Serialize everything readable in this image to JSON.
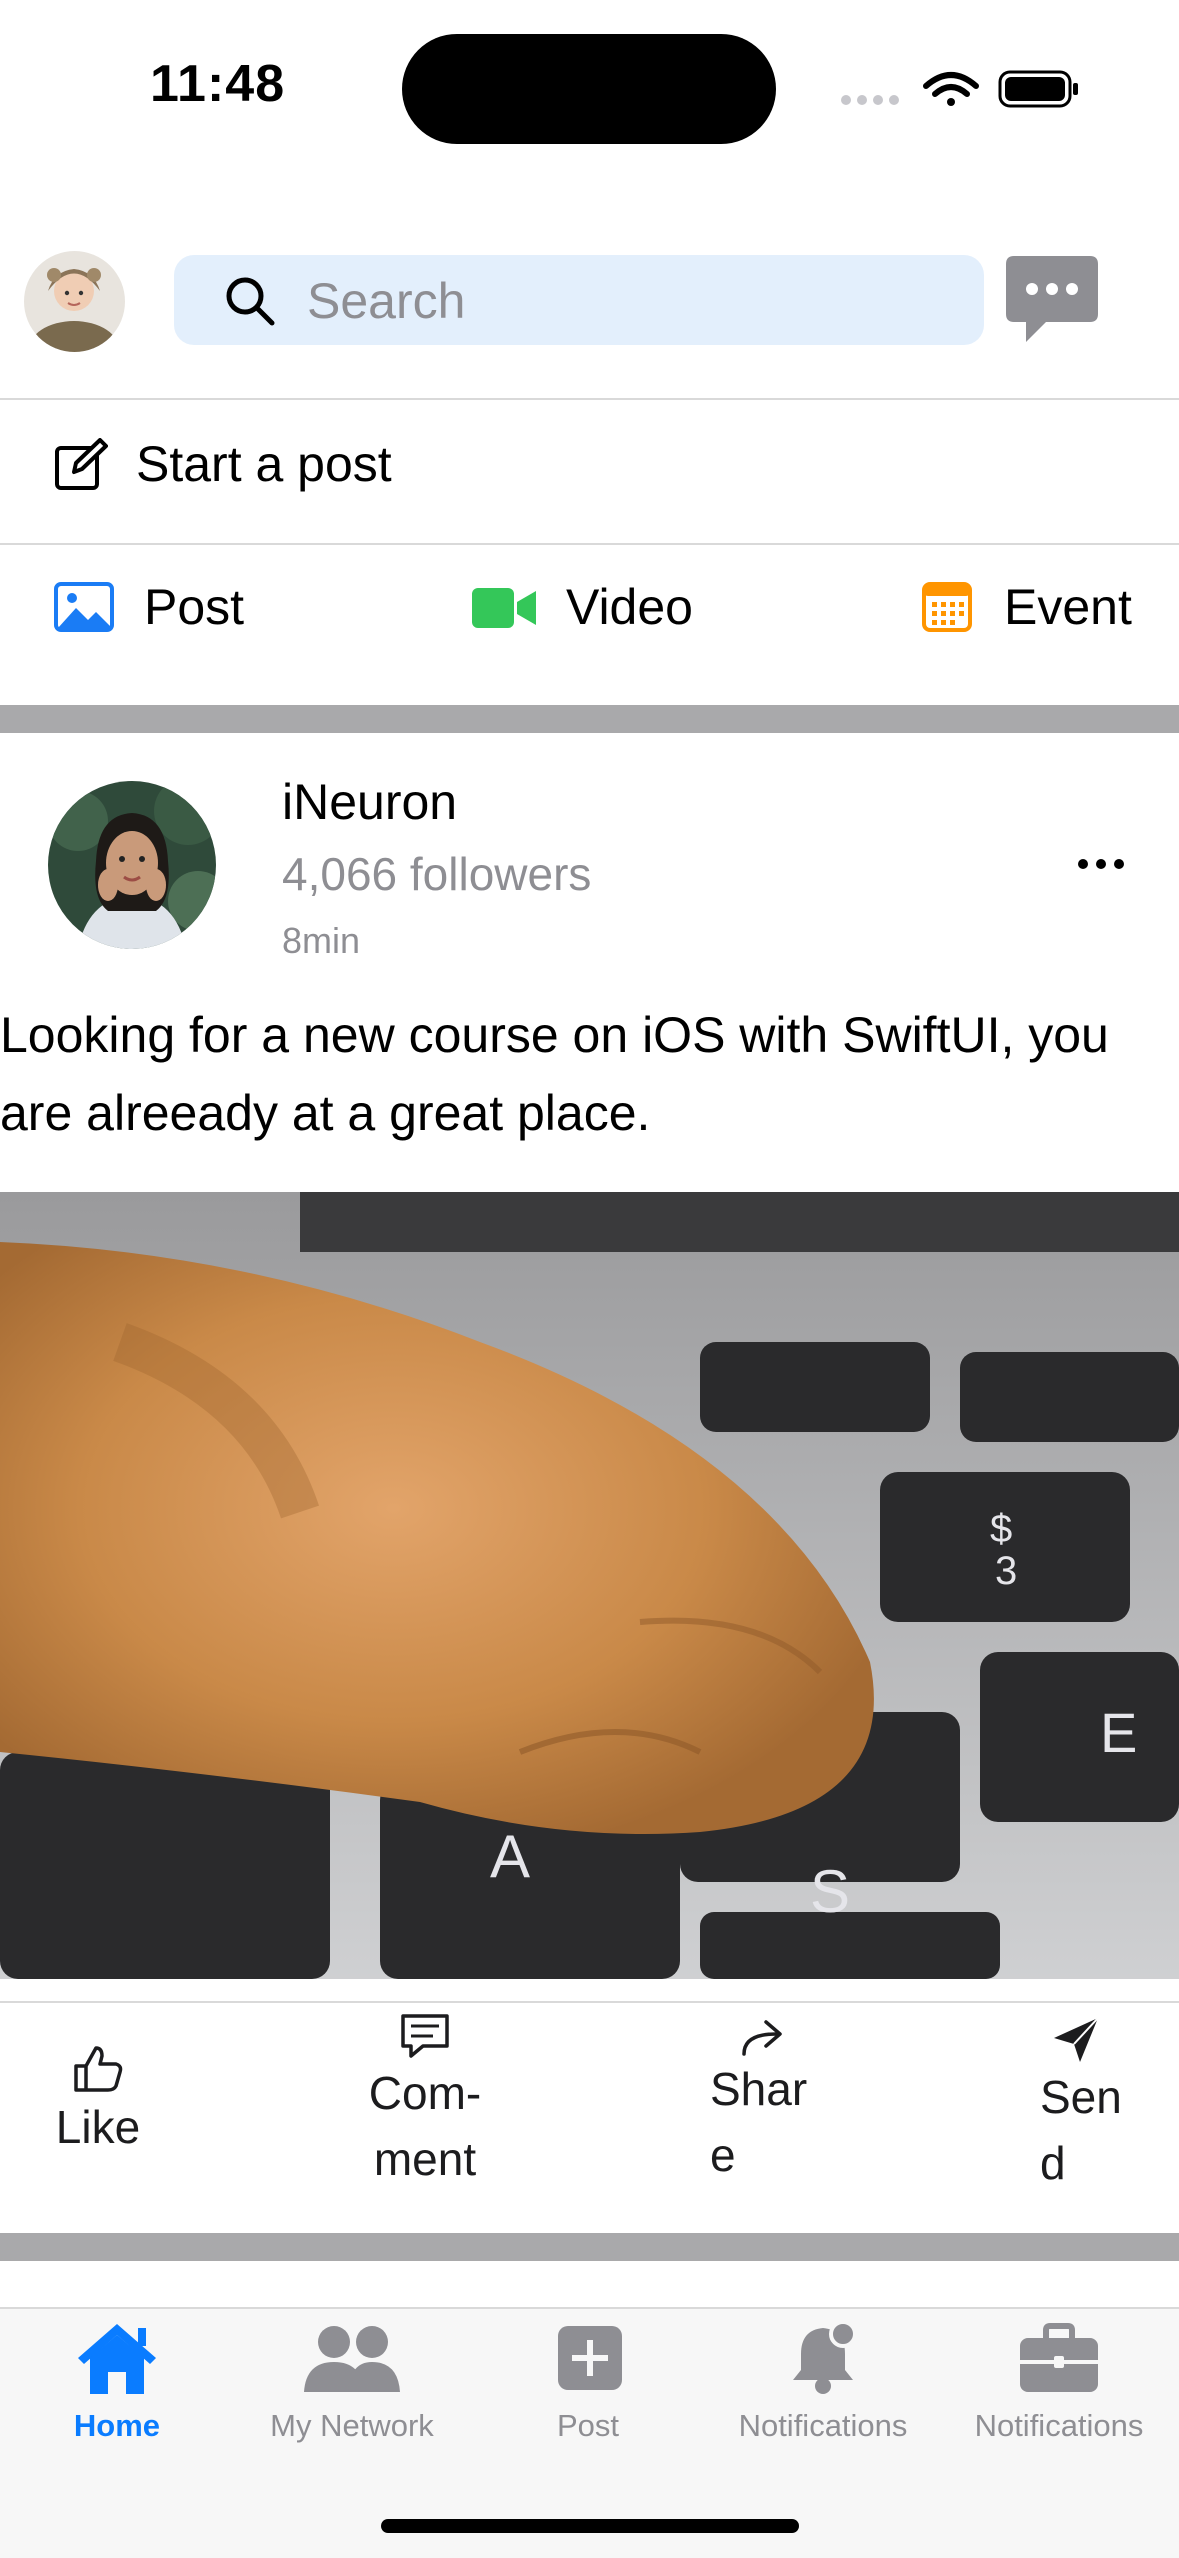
{
  "status_bar": {
    "time": "11:48"
  },
  "header": {
    "search_placeholder": "Search"
  },
  "composer": {
    "start_post": "Start a post",
    "actions": [
      {
        "label": "Post",
        "icon": "photo-icon",
        "color": "#1a7cf5"
      },
      {
        "label": "Video",
        "icon": "video-icon",
        "color": "#34c759"
      },
      {
        "label": "Event",
        "icon": "calendar-icon",
        "color": "#ff9500"
      }
    ]
  },
  "post": {
    "author": "iNeuron",
    "followers": "4,066 followers",
    "time": "8min",
    "text": "Looking for a new course on iOS with SwiftUI, you are alreeady at a great place.",
    "image_alt": "cat paw on laptop keyboard",
    "reactions": [
      {
        "line1": "Like",
        "line2": "",
        "icon": "thumbs-up-icon"
      },
      {
        "line1": "Com-",
        "line2": "ment",
        "icon": "comment-icon"
      },
      {
        "line1": "Shar",
        "line2": "e",
        "icon": "share-icon"
      },
      {
        "line1": "Sen",
        "line2": "d",
        "icon": "send-icon"
      }
    ]
  },
  "tabbar": {
    "accent": "#0a7cff",
    "items": [
      {
        "label": "Home",
        "icon": "house-icon",
        "active": true
      },
      {
        "label": "My Network",
        "icon": "people-icon",
        "active": false
      },
      {
        "label": "Post",
        "icon": "plus-square-icon",
        "active": false
      },
      {
        "label": "Notifications",
        "icon": "bell-icon",
        "active": false
      },
      {
        "label": "Notifications",
        "icon": "briefcase-icon",
        "active": false
      }
    ]
  }
}
